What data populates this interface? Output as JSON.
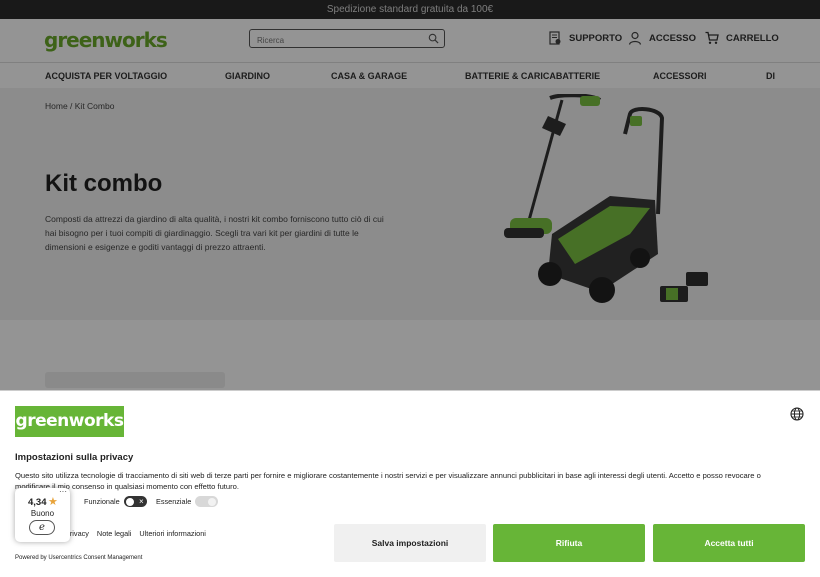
{
  "topbar": {
    "text": "Spedizione standard gratuita da 100€"
  },
  "header": {
    "logo": "greenworks",
    "search_placeholder": "Ricerca",
    "support": "SUPPORTO",
    "account": "ACCESSO",
    "cart": "CARRELLO"
  },
  "nav": {
    "items": [
      {
        "label": "ACQUISTA PER VOLTAGGIO"
      },
      {
        "label": "GIARDINO"
      },
      {
        "label": "CASA & GARAGE"
      },
      {
        "label": "BATTERIE & CARICABATTERIE"
      },
      {
        "label": "ACCESSORI"
      },
      {
        "label": "DI"
      }
    ]
  },
  "hero": {
    "breadcrumb": "Home / Kit Combo",
    "title": "Kit combo",
    "description": "Composti da attrezzi da giardino di alta qualità, i nostri kit combo forniscono tutto ciò di cui hai bisogno per i tuoi compiti di giardinaggio. Scegli tra vari kit per giardini di tutte le dimensioni e esigenze e goditi vantaggi di prezzo attraenti."
  },
  "consent": {
    "logo": "greenworks",
    "title": "Impostazioni sulla privacy",
    "description": "Questo sito utilizza tecnologie di tracciamento di siti web di terze parti per fornire e migliorare costantemente i nostri servizi e per visualizzare annunci pubblicitari in base agli interessi degli utenti. Accetto e posso revocare o modificare il mio consenso in qualsiasi momento con effetto futuro.",
    "toggles": [
      {
        "label": "Funzionale"
      },
      {
        "label": "Essenziale"
      }
    ],
    "links": [
      {
        "label": "Privacy"
      },
      {
        "label": "Note legali"
      },
      {
        "label": "Ulteriori informazioni"
      }
    ],
    "powered": "Powered by Usercentrics Consent Management",
    "buttons": {
      "save": "Salva impostazioni",
      "reject": "Rifiuta",
      "accept": "Accetta tutti"
    }
  },
  "rating": {
    "score": "4,34",
    "label": "Buono",
    "badge": "e",
    "more": "···"
  },
  "colors": {
    "brand_green": "#67b537",
    "topbar": "#2b2b2b"
  }
}
